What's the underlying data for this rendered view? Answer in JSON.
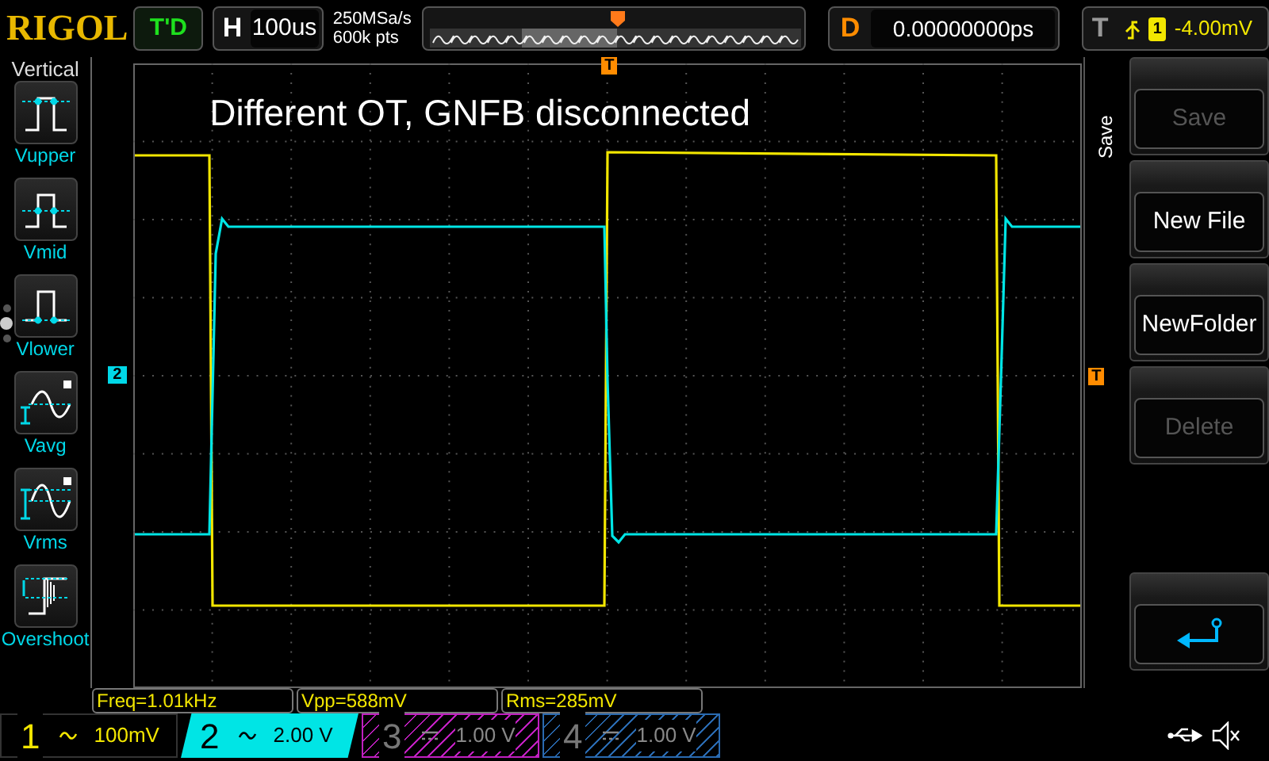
{
  "brand": "RIGOL",
  "run_status": "T'D",
  "horizontal": {
    "label": "H",
    "timebase": "100us"
  },
  "acquisition": {
    "sample_rate": "250MSa/s",
    "memory_depth": "600k pts"
  },
  "delay": {
    "label": "D",
    "value": "0.00000000ps"
  },
  "trigger": {
    "label": "T",
    "source": "1",
    "level": "-4.00mV"
  },
  "measure_menu": {
    "title": "Vertical",
    "items": [
      {
        "label": "Vupper",
        "kind": "vupper"
      },
      {
        "label": "Vmid",
        "kind": "vmid"
      },
      {
        "label": "Vlower",
        "kind": "vlower"
      },
      {
        "label": "Vavg",
        "kind": "vavg"
      },
      {
        "label": "Vrms",
        "kind": "vrms"
      },
      {
        "label": "Overshoot",
        "kind": "overshoot"
      }
    ],
    "pages": [
      {
        "selected": false
      },
      {
        "selected": true
      },
      {
        "selected": false
      }
    ]
  },
  "annotation": "Different OT, GNFB disconnected",
  "channel_marker": "2",
  "trigger_markers": [
    "T",
    "T"
  ],
  "softkeys": {
    "title": "Save",
    "buttons": [
      {
        "kind": "text",
        "label": "Save",
        "disabled": true
      },
      {
        "kind": "text",
        "label": "New File",
        "disabled": false
      },
      {
        "kind": "text",
        "label": "NewFolder",
        "disabled": false
      },
      {
        "kind": "text",
        "label": "Delete",
        "disabled": true
      },
      {
        "kind": "spacer"
      },
      {
        "kind": "back"
      }
    ]
  },
  "measurements": [
    "Freq=1.01kHz",
    "Vpp=588mV",
    "Rms=285mV"
  ],
  "channels": [
    {
      "number": "1",
      "kind": "ac",
      "scale": "100mV",
      "on": true,
      "selected": false,
      "color": "#f2e600"
    },
    {
      "number": "2",
      "kind": "ac",
      "scale": "2.00 V",
      "on": true,
      "selected": true,
      "color": "#00e5e5"
    },
    {
      "number": "3",
      "kind": "dc",
      "scale": "1.00 V",
      "on": false,
      "selected": false,
      "color": "#c020c0"
    },
    {
      "number": "4",
      "kind": "dc",
      "scale": "1.00 V",
      "on": false,
      "selected": false,
      "color": "#2a6ab0"
    }
  ]
}
